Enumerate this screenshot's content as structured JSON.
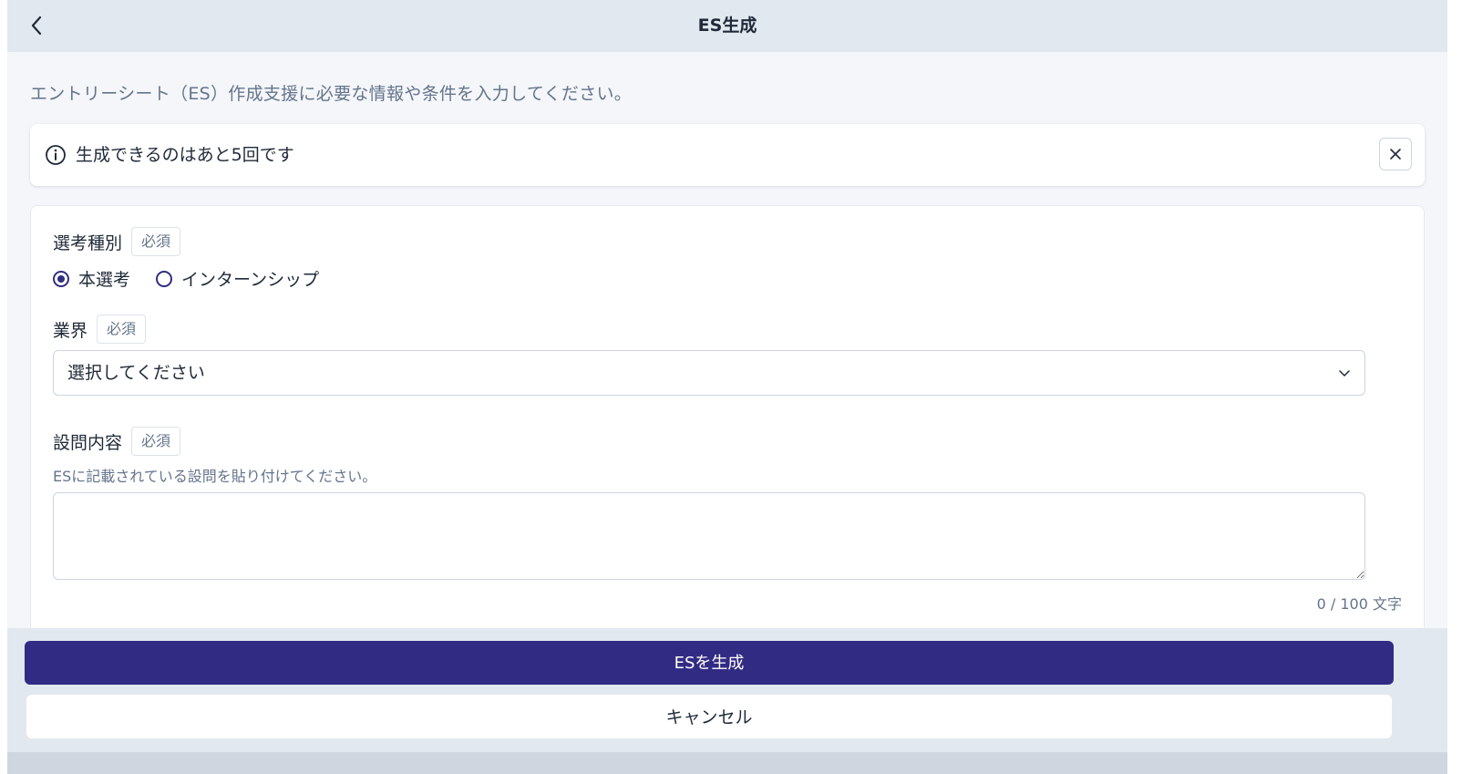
{
  "header": {
    "title": "ES生成",
    "back_icon": "chevron-left-icon"
  },
  "intro_text": "エントリーシート（ES）作成支援に必要な情報や条件を入力してください。",
  "notice": {
    "icon": "info-icon",
    "text": "生成できるのはあと5回です",
    "close_icon": "close-icon"
  },
  "form": {
    "selection_type": {
      "label": "選考種別",
      "required_badge": "必須",
      "options": [
        {
          "label": "本選考",
          "checked": true
        },
        {
          "label": "インターンシップ",
          "checked": false
        }
      ]
    },
    "industry": {
      "label": "業界",
      "required_badge": "必須",
      "selected_value": "選択してください",
      "chevron_icon": "chevron-down-icon"
    },
    "question": {
      "label": "設問内容",
      "required_badge": "必須",
      "help_text": "ESに記載されている設問を貼り付けてください。",
      "value": "",
      "counter": "0 / 100 文字"
    }
  },
  "actions": {
    "primary_label": "ESを生成",
    "secondary_label": "キャンセル"
  },
  "colors": {
    "primary": "#322b84",
    "header_bg": "#e2e8f0",
    "muted_text": "#64748b"
  }
}
